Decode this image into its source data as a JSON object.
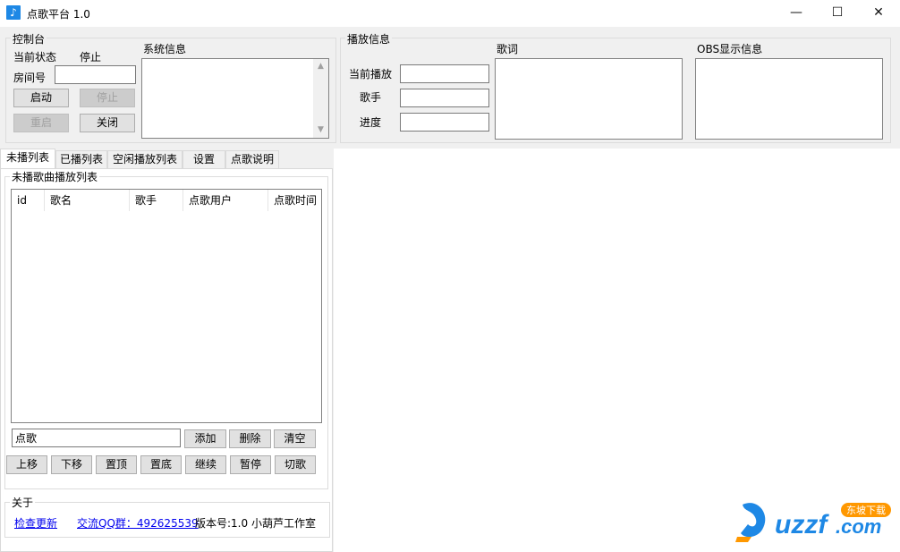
{
  "window": {
    "title": "点歌平台 1.0",
    "minimize": "—",
    "maximize": "☐",
    "close": "✕",
    "icon": "music-note-icon"
  },
  "console": {
    "group_title": "控制台",
    "status_label": "当前状态",
    "status_value": "停止",
    "room_label": "房间号",
    "room_value": "",
    "start_button": "启动",
    "stop_button": "停止",
    "restart_button": "重启",
    "close_button": "关闭",
    "system_info_label": "系统信息"
  },
  "playback": {
    "group_title": "播放信息",
    "current_label": "当前播放",
    "current_value": "",
    "singer_label": "歌手",
    "singer_value": "",
    "progress_label": "进度",
    "progress_value": "",
    "lyrics_label": "歌词",
    "obs_label": "OBS显示信息"
  },
  "tabs": [
    {
      "label": "未播列表",
      "active": true
    },
    {
      "label": "已播列表",
      "active": false
    },
    {
      "label": "空闲播放列表",
      "active": false
    },
    {
      "label": "设置",
      "active": false
    },
    {
      "label": "点歌说明",
      "active": false
    }
  ],
  "playlist": {
    "group_title": "未播歌曲播放列表",
    "columns": [
      "id",
      "歌名",
      "歌手",
      "点歌用户",
      "点歌时间"
    ],
    "rows": [],
    "song_input_value": "点歌",
    "add_button": "添加",
    "delete_button": "删除",
    "clear_button": "清空",
    "move_up_button": "上移",
    "move_down_button": "下移",
    "top_button": "置顶",
    "bottom_button": "置底",
    "continue_button": "继续",
    "pause_button": "暂停",
    "skip_button": "切歌"
  },
  "about": {
    "group_title": "关于",
    "check_update": "检查更新",
    "qq_group": "交流QQ群：492625539",
    "version": "版本号:1.0 小葫芦工作室"
  },
  "watermark": {
    "brand": "uzzf.com",
    "tagline": "东坡下载"
  }
}
